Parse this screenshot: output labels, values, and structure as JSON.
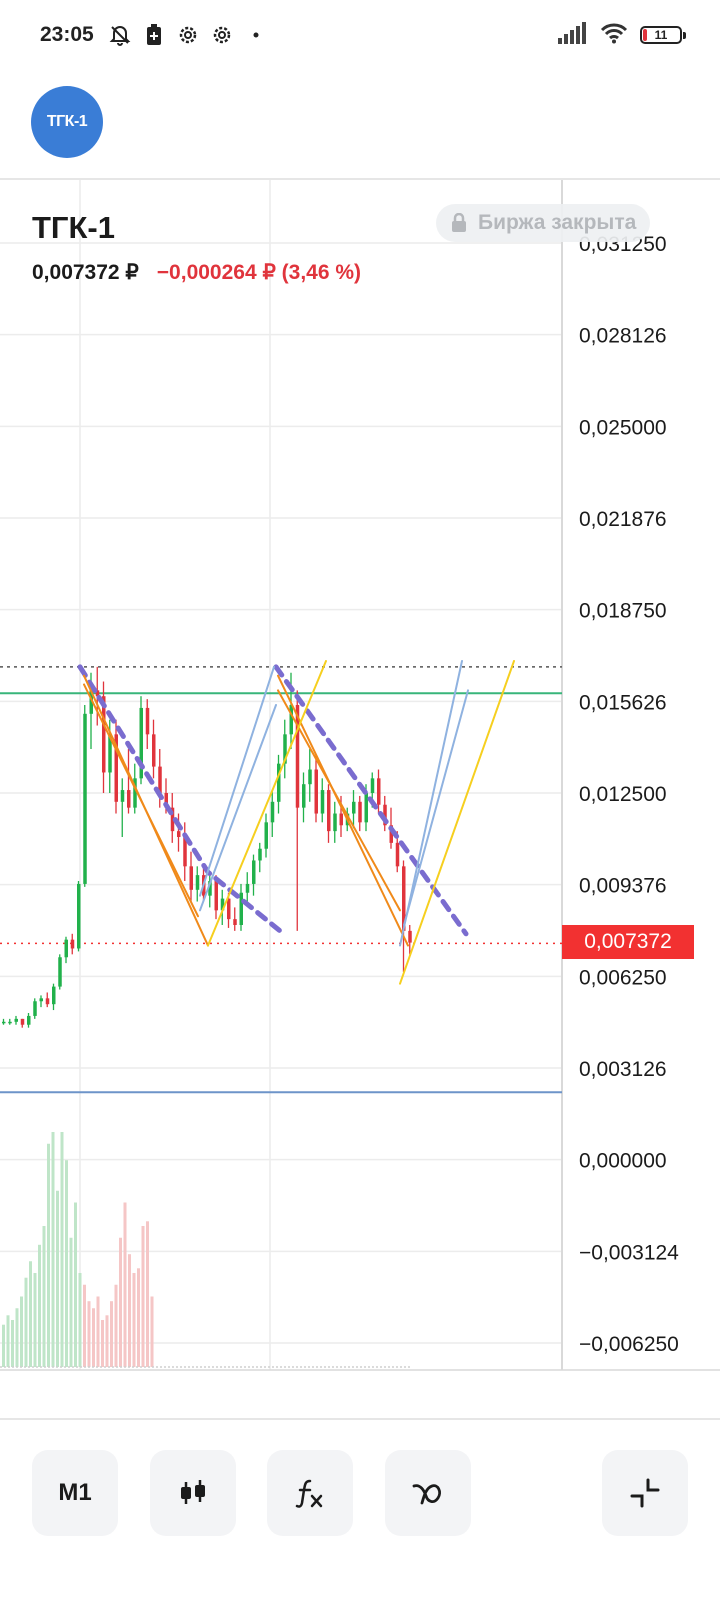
{
  "status_bar": {
    "time": "23:05",
    "battery": "11",
    "icons": [
      "bell-off-icon",
      "battery-saver-icon",
      "settings-gear-icon",
      "settings-gear-icon",
      "dot-icon",
      "signal-icon",
      "wifi-icon",
      "battery-icon"
    ]
  },
  "header": {
    "logo_text": "ТГК-1"
  },
  "instrument": {
    "ticker": "ТГК-1",
    "price": "0,007372 ₽",
    "change": "−0,000264 ₽ (3,46 %)",
    "exchange_status": "Биржа закрыта"
  },
  "colors": {
    "up": "#21b14b",
    "down": "#e0343c",
    "accent": "#f23131",
    "trend_purple": "#7a6ccf",
    "trend_orange": "#f08a1a",
    "trend_yellow": "#f6cf1f",
    "trend_blue": "#8fb2e0",
    "level_green": "#38b57a",
    "level_blue": "#6d94c9"
  },
  "chart_data": {
    "type": "candlestick",
    "y_axis_labels": [
      "0,031250",
      "0,028126",
      "0,025000",
      "0,021876",
      "0,018750",
      "0,015626",
      "0,012500",
      "0,009376",
      "0,006250",
      "0,003126",
      "0,000000",
      "−0,003124",
      "−0,006250"
    ],
    "ylim": [
      -0.00625,
      0.03125
    ],
    "current_price": 0.007372,
    "current_price_label": "0,007372",
    "resistance_level": 0.0159,
    "support_level": 0.0023,
    "peak_level": 0.0168,
    "grid": true,
    "candles": [
      [
        0.0047,
        0.0048,
        0.0046,
        0.0047
      ],
      [
        0.0047,
        0.0048,
        0.0046,
        0.0047
      ],
      [
        0.0047,
        0.0049,
        0.0046,
        0.0048
      ],
      [
        0.0048,
        0.0048,
        0.0045,
        0.0046
      ],
      [
        0.0046,
        0.005,
        0.0045,
        0.0049
      ],
      [
        0.0049,
        0.0055,
        0.0048,
        0.0054
      ],
      [
        0.0054,
        0.0056,
        0.0052,
        0.0055
      ],
      [
        0.0055,
        0.0057,
        0.0052,
        0.0053
      ],
      [
        0.0053,
        0.006,
        0.0051,
        0.0059
      ],
      [
        0.0059,
        0.007,
        0.0058,
        0.0069
      ],
      [
        0.0069,
        0.0076,
        0.0067,
        0.0075
      ],
      [
        0.0075,
        0.0077,
        0.007,
        0.0072
      ],
      [
        0.0072,
        0.0095,
        0.0071,
        0.0094
      ],
      [
        0.0094,
        0.0155,
        0.0093,
        0.0152
      ],
      [
        0.0152,
        0.0166,
        0.014,
        0.016
      ],
      [
        0.016,
        0.0168,
        0.0148,
        0.0158
      ],
      [
        0.0158,
        0.0163,
        0.0125,
        0.0132
      ],
      [
        0.0132,
        0.015,
        0.0125,
        0.0145
      ],
      [
        0.0145,
        0.015,
        0.0118,
        0.0122
      ],
      [
        0.0122,
        0.013,
        0.011,
        0.0126
      ],
      [
        0.0126,
        0.014,
        0.0118,
        0.012
      ],
      [
        0.012,
        0.0135,
        0.0118,
        0.013
      ],
      [
        0.013,
        0.0158,
        0.0128,
        0.0154
      ],
      [
        0.0154,
        0.0157,
        0.014,
        0.0145
      ],
      [
        0.0145,
        0.015,
        0.013,
        0.0134
      ],
      [
        0.0134,
        0.014,
        0.012,
        0.0125
      ],
      [
        0.0125,
        0.013,
        0.0118,
        0.012
      ],
      [
        0.012,
        0.0125,
        0.0108,
        0.0112
      ],
      [
        0.0112,
        0.0118,
        0.0105,
        0.011
      ],
      [
        0.011,
        0.0115,
        0.0095,
        0.01
      ],
      [
        0.01,
        0.0105,
        0.0088,
        0.0092
      ],
      [
        0.0092,
        0.01,
        0.0088,
        0.0097
      ],
      [
        0.0097,
        0.01,
        0.0088,
        0.009
      ],
      [
        0.009,
        0.0098,
        0.0086,
        0.0095
      ],
      [
        0.0095,
        0.0097,
        0.0082,
        0.0085
      ],
      [
        0.0085,
        0.0092,
        0.008,
        0.0089
      ],
      [
        0.0089,
        0.0091,
        0.0079,
        0.0082
      ],
      [
        0.0082,
        0.0086,
        0.0078,
        0.008
      ],
      [
        0.008,
        0.0094,
        0.0078,
        0.0091
      ],
      [
        0.0091,
        0.0098,
        0.0088,
        0.0094
      ],
      [
        0.0094,
        0.0104,
        0.009,
        0.0102
      ],
      [
        0.0102,
        0.0108,
        0.0098,
        0.0106
      ],
      [
        0.0106,
        0.0118,
        0.0103,
        0.0115
      ],
      [
        0.0115,
        0.0126,
        0.011,
        0.0122
      ],
      [
        0.0122,
        0.0138,
        0.0118,
        0.0135
      ],
      [
        0.0135,
        0.015,
        0.013,
        0.0145
      ],
      [
        0.0145,
        0.0166,
        0.014,
        0.0155
      ],
      [
        0.0155,
        0.016,
        0.0078,
        0.012
      ],
      [
        0.012,
        0.0132,
        0.0115,
        0.0128
      ],
      [
        0.0128,
        0.014,
        0.0122,
        0.0133
      ],
      [
        0.0133,
        0.0138,
        0.0115,
        0.0118
      ],
      [
        0.0118,
        0.013,
        0.0115,
        0.0126
      ],
      [
        0.0126,
        0.0128,
        0.0108,
        0.0112
      ],
      [
        0.0112,
        0.0122,
        0.0108,
        0.0118
      ],
      [
        0.0118,
        0.0124,
        0.011,
        0.0114
      ],
      [
        0.0114,
        0.012,
        0.0112,
        0.0118
      ],
      [
        0.0118,
        0.0126,
        0.0113,
        0.0122
      ],
      [
        0.0122,
        0.0124,
        0.0112,
        0.0115
      ],
      [
        0.0115,
        0.0128,
        0.0112,
        0.0125
      ],
      [
        0.0125,
        0.0132,
        0.012,
        0.013
      ],
      [
        0.013,
        0.0133,
        0.0118,
        0.0121
      ],
      [
        0.0121,
        0.0124,
        0.0112,
        0.0114
      ],
      [
        0.0114,
        0.012,
        0.0106,
        0.0108
      ],
      [
        0.0108,
        0.0112,
        0.0098,
        0.01
      ],
      [
        0.01,
        0.0102,
        0.0064,
        0.0078
      ],
      [
        0.0078,
        0.008,
        0.007,
        0.0074
      ]
    ],
    "volumes": [
      0.18,
      0.22,
      0.2,
      0.25,
      0.3,
      0.38,
      0.45,
      0.4,
      0.52,
      0.6,
      0.95,
      1.0,
      0.75,
      1.0,
      0.88,
      0.55,
      0.7,
      0.4,
      0.35,
      0.28,
      0.25,
      0.3,
      0.2,
      0.22,
      0.28,
      0.35,
      0.55,
      0.7,
      0.48,
      0.4,
      0.42,
      0.6,
      0.62,
      0.3
    ]
  },
  "toolbar": {
    "timeframe_label": "M1",
    "candles_icon": "candlestick-icon",
    "indicators_icon": "function-icon",
    "drawing_icon": "drawing-tool-icon",
    "fullscreen_icon": "collapse-icon"
  }
}
